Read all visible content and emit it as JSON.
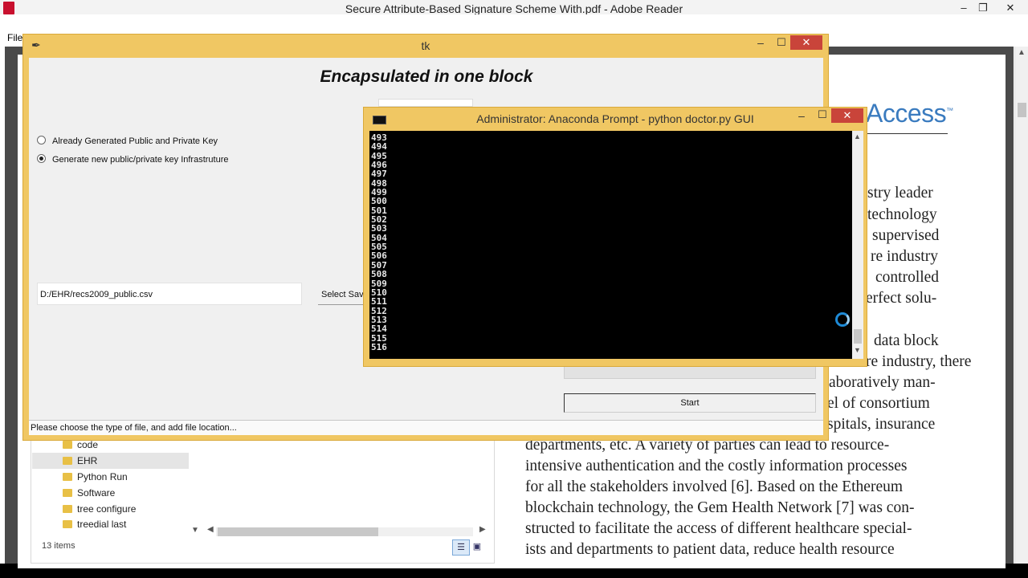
{
  "reader": {
    "title": "Secure Attribute-Based Signature Scheme With.pdf - Adobe Reader",
    "menu_file": "File",
    "controls": {
      "minimize": "–",
      "restore": "❐",
      "close": "✕"
    }
  },
  "paper": {
    "logo": "Access",
    "logo_mark": "™",
    "lines_right": [
      "stry leader",
      "technology",
      "supervised",
      "re industry",
      "controlled",
      "erfect solu-",
      "data block",
      "re industry, there",
      "aboratively man-",
      "el of consortium",
      "spitals, insurance"
    ],
    "lines_full": [
      "departments, etc. A variety of parties can lead to resource-",
      "intensive authentication and the costly information processes",
      "for all the stakeholders involved [6]. Based on the Ethereum",
      "blockchain technology, the Gem Health Network [7] was con-",
      "structed to facilitate the access of different healthcare special-",
      "ists and departments to patient data, reduce health resource"
    ]
  },
  "explorer": {
    "folders": [
      {
        "label": "code",
        "selected": false
      },
      {
        "label": "EHR",
        "selected": true
      },
      {
        "label": "Python Run",
        "selected": false
      },
      {
        "label": "Software",
        "selected": false
      },
      {
        "label": "tree configure",
        "selected": false
      },
      {
        "label": "treedial last",
        "selected": false
      }
    ],
    "items_count": "13 items"
  },
  "tk": {
    "title": "tk",
    "heading": "Encapsulated in one block",
    "radio_options": [
      {
        "label": "Already Generated Public and Private Key",
        "selected": false
      },
      {
        "label": "Generate new public/private key Infrastruture",
        "selected": true
      }
    ],
    "file_path": "D:/EHR/recs2009_public.csv",
    "select_save_label": "Select Save",
    "start_label": "Start",
    "status": "Please choose the type of file, and add file location...",
    "controls": {
      "minimize": "–",
      "maximize": "☐",
      "close": "✕"
    }
  },
  "prompt": {
    "title": "Administrator: Anaconda Prompt - python  doctor.py GUI",
    "lines": [
      "493",
      "494",
      "495",
      "496",
      "497",
      "498",
      "499",
      "500",
      "501",
      "502",
      "503",
      "504",
      "505",
      "506",
      "507",
      "508",
      "509",
      "510",
      "511",
      "512",
      "513",
      "514",
      "515",
      "516"
    ],
    "controls": {
      "minimize": "–",
      "maximize": "☐",
      "close": "✕"
    }
  },
  "colors": {
    "window_frame": "#f0c763",
    "close_button": "#c9443a",
    "access_logo": "#3a7bbf"
  }
}
